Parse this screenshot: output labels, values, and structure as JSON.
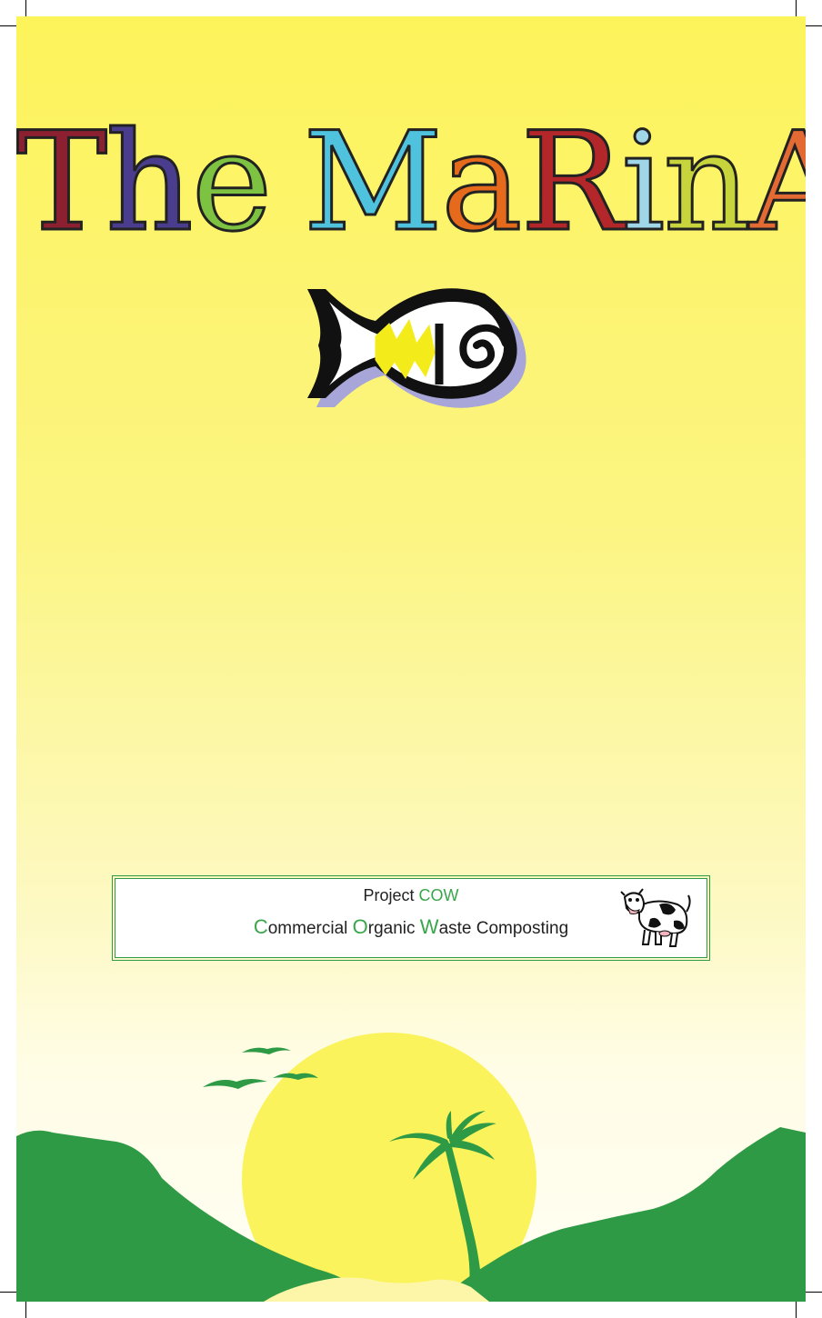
{
  "title": {
    "letters": [
      "T",
      "h",
      "e",
      " ",
      "M",
      "a",
      "R",
      "i",
      "n",
      "A"
    ],
    "colors": [
      "#8c2031",
      "#4a3d8e",
      "#7ec242",
      "",
      "#4fc3dd",
      "#e56a1c",
      "#b3262a",
      "#9fd6e8",
      "#c7d43b",
      "#e36a33"
    ]
  },
  "cow_box": {
    "line1_prefix": "Project ",
    "line1_highlight": "COW",
    "line2": [
      {
        "initial": "C",
        "rest": "ommercial "
      },
      {
        "initial": "O",
        "rest": "rganic "
      },
      {
        "initial": "W",
        "rest": "aste Composting"
      }
    ]
  },
  "colors": {
    "background": "#fdf35a",
    "hills": "#2e9a45",
    "sun": "#fbf35c",
    "accent_green": "#3aa64a"
  },
  "icons": {
    "logo": "fish-logo-icon",
    "cow": "cow-icon",
    "birds": "birds-icon",
    "palm": "palm-tree-icon",
    "sun": "sun-icon"
  }
}
